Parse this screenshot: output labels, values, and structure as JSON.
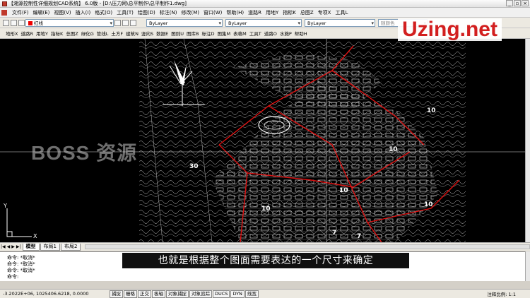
{
  "titlebar": {
    "title": "【湘源控制性详细规划CAD系统】 6.0版 - [D:\\压力网\\总平制作\\总平制作1.dwg]",
    "window_buttons": [
      "_",
      "▫",
      "×"
    ]
  },
  "menu": [
    "文件(F)",
    "编辑(E)",
    "视图(V)",
    "插入(I)",
    "格式(O)",
    "工具(T)",
    "绘图(D)",
    "标注(N)",
    "修改(M)",
    "窗口(W)",
    "帮助(H)",
    "道路R",
    "用地Y",
    "指标K",
    "总图Z",
    "专项X",
    "工具L"
  ],
  "toolbar1": {
    "layer": "红线",
    "color": "ByLayer",
    "linetype": "ByLayer",
    "lineweight": "ByLayer",
    "plotstyle": "随颜色"
  },
  "toolbar2": [
    "地形X",
    "道路R",
    "用地Y",
    "指标K",
    "总图Z",
    "绿化G",
    "管线L",
    "土方F",
    "建筑N",
    "竖向S",
    "数据E",
    "图则U",
    "图库B",
    "标注D",
    "图集M",
    "表格M",
    "工具T",
    "道路O",
    "水施P",
    "帮助H"
  ],
  "watermark": "Uzing.net",
  "overlay_brand": "BOSS 资源",
  "drawing": {
    "labels": [
      "30",
      "10",
      "10",
      "10",
      "10",
      "7",
      "7",
      "10"
    ],
    "ucs_y": "Y",
    "ucs_x": "X"
  },
  "tabs": {
    "nav": [
      "|◀",
      "◀",
      "▶",
      "▶|"
    ],
    "items": [
      "模型",
      "布局1",
      "布局2"
    ]
  },
  "command": {
    "lines": [
      "命令: *取消*",
      "命令: *取消*",
      "命令: *取消*",
      "命令:"
    ]
  },
  "subtitle": "也就是根据整个图面需要表达的一个尺寸来确定",
  "status": {
    "coords": "-3.2022E+06, 1025406.6218, 0.0000",
    "toggles": [
      "捕捉",
      "栅格",
      "正交",
      "极轴",
      "对象捕捉",
      "对象追踪",
      "DUCS",
      "DYN",
      "线宽"
    ],
    "scale_label": "注释比例:",
    "scale_value": "1:1"
  },
  "colors": {
    "canvas": "#000000",
    "parcel_red": "#e01010",
    "watermark_red": "#d21f1f"
  }
}
